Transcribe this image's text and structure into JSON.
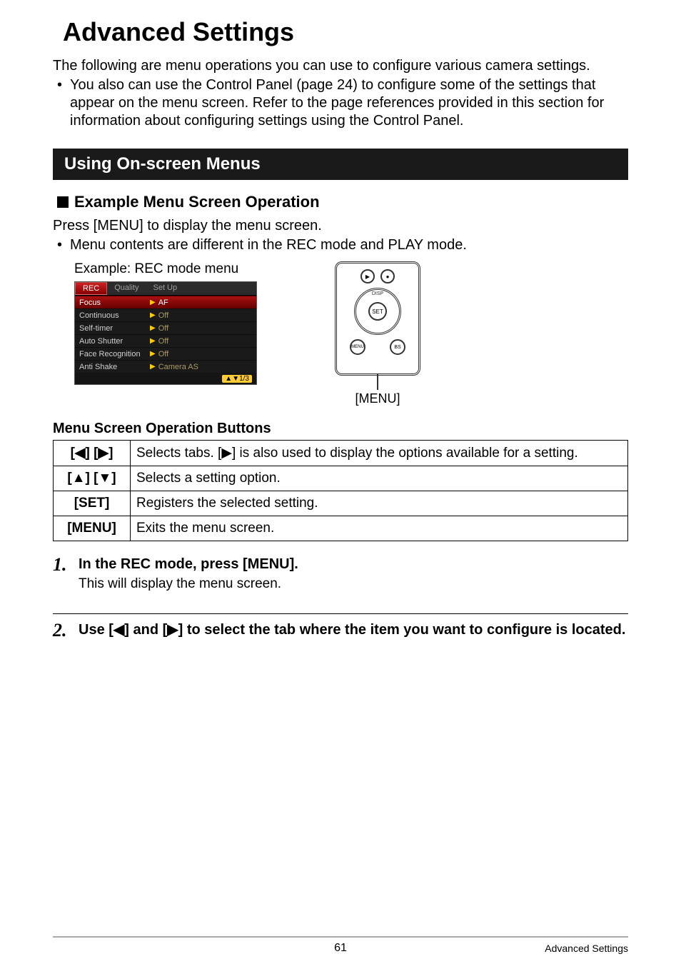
{
  "title": "Advanced Settings",
  "intro": "The following are menu operations you can use to configure various camera settings.",
  "intro_bullet": "You also can use the Control Panel (page 24) to configure some of the settings that appear on the menu screen. Refer to the page references provided in this section for information about configuring settings using the Control Panel.",
  "section_bar": "Using On-screen Menus",
  "sub_heading": "Example Menu Screen Operation",
  "sub_para": "Press [MENU] to display the menu screen.",
  "sub_bullet": "Menu contents are different in the REC mode and PLAY mode.",
  "example_caption": "Example: REC mode menu",
  "rec_menu": {
    "tabs": [
      "REC",
      "Quality",
      "Set Up"
    ],
    "items": [
      {
        "name": "Focus",
        "value": "AF",
        "selected": true
      },
      {
        "name": "Continuous",
        "value": "Off",
        "selected": false
      },
      {
        "name": "Self-timer",
        "value": "Off",
        "selected": false
      },
      {
        "name": "Auto Shutter",
        "value": "Off",
        "selected": false
      },
      {
        "name": "Face Recognition",
        "value": "Off",
        "selected": false
      },
      {
        "name": "Anti Shake",
        "value": "Camera AS",
        "selected": false
      }
    ],
    "page_indicator": "▲▼1/3"
  },
  "controller": {
    "top_left_icon": "play-icon",
    "top_right_icon": "record-icon",
    "ring_top": "DISP",
    "ring_center": "SET",
    "ring_bottom": "",
    "bottom_left": "MENU",
    "bottom_right": "BS",
    "caption": "[MENU]"
  },
  "table_caption": "Menu Screen Operation Buttons",
  "ops": [
    {
      "key": "[◀] [▶]",
      "desc": "Selects tabs. [▶] is also used to display the options available for a setting."
    },
    {
      "key": "[▲] [▼]",
      "desc": "Selects a setting option."
    },
    {
      "key": "[SET]",
      "desc": "Registers the selected setting."
    },
    {
      "key": "[MENU]",
      "desc": "Exits the menu screen."
    }
  ],
  "steps": [
    {
      "num": "1.",
      "title": "In the REC mode, press [MENU].",
      "desc": "This will display the menu screen."
    },
    {
      "num": "2.",
      "title": "Use [◀] and [▶] to select the tab where the item you want to configure is located.",
      "desc": ""
    }
  ],
  "footer": {
    "page": "61",
    "right": "Advanced Settings"
  }
}
